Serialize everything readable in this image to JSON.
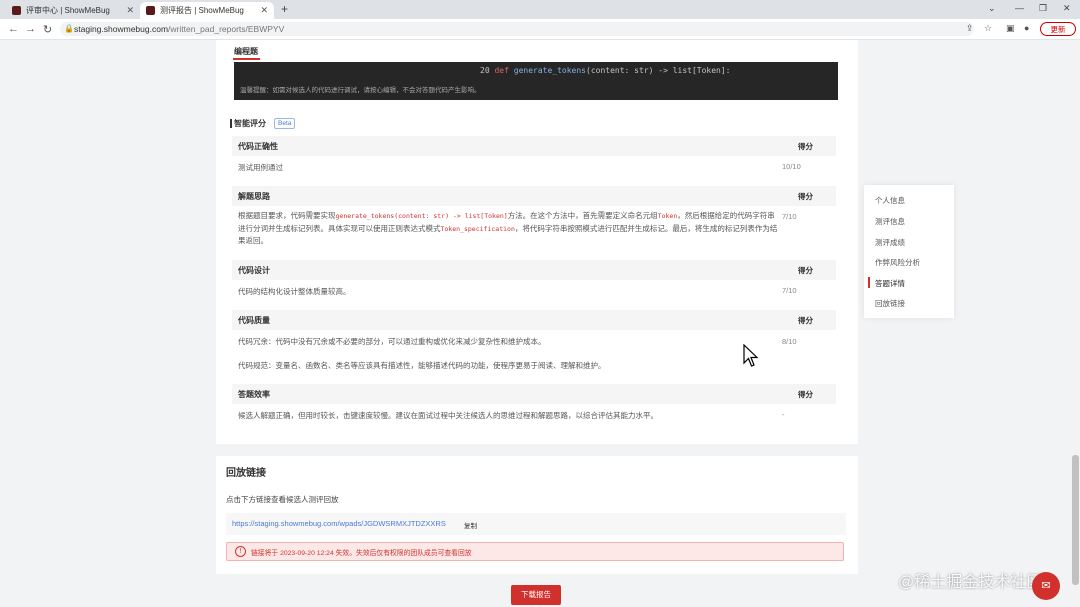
{
  "browser": {
    "tabs": [
      {
        "label": "评审中心 | ShowMeBug"
      },
      {
        "label": "测评报告 | ShowMeBug"
      }
    ],
    "url_host": "staging.showmebug.com",
    "url_path": "/written_pad_reports/EBWPYV",
    "update_label": "更新"
  },
  "code_section": {
    "tab_label": "编程题",
    "code_line_number": "20",
    "code_line_keyword": "def",
    "code_line_fn": "generate_tokens",
    "code_line_rest": "(content: str) -> list[Token]:",
    "notice": "温馨提醒：如需对候选人的代码进行调试，请按心编辑，不会对答题代码产生影响。"
  },
  "ai_score": {
    "title": "智能评分",
    "beta": "Beta",
    "sections": [
      {
        "heading": "代码正确性",
        "score_header": "得分",
        "text": "测试用例通过",
        "score": "10/10"
      },
      {
        "heading": "解题思路",
        "score_header": "得分",
        "text_parts": [
          "根据题目要求，代码需要实现",
          "generate_tokens(content: str) -> list[Token]",
          "方法。在这个方法中，首先需要定义命名元组",
          "Token",
          "，然后根据给定的代码字符串进行分词并生成标记列表。具体实现可以使用正则表达式模式",
          "Token_specification",
          "，将代码字符串按照模式进行匹配并生成标记。最后，将生成的标记列表作为结果返回。"
        ],
        "score": "7/10"
      },
      {
        "heading": "代码设计",
        "score_header": "得分",
        "text": "代码的结构化设计整体质量较高。",
        "score": "7/10"
      },
      {
        "heading": "代码质量",
        "score_header": "得分",
        "text": "代码冗余：代码中没有冗余或不必要的部分，可以通过重构或优化来减少复杂性和维护成本。",
        "text2": "代码规范：变量名、函数名、类名等应该具有描述性，能够描述代码的功能，使程序更易于阅读、理解和维护。",
        "score": "8/10"
      },
      {
        "heading": "答题效率",
        "score_header": "得分",
        "text": "候选人解题正确，但用时较长，击键速度较慢。建议在面试过程中关注候选人的思维过程和解题思路，以综合评估其能力水平。",
        "score": "-"
      }
    ]
  },
  "replay": {
    "title": "回放链接",
    "desc": "点击下方链接查看候选人测评回放",
    "link": "https://staging.showmebug.com/wpads/JGDWSRMXJTDZXXRS",
    "copy": "复制",
    "warning": "链接将于 2023-09-20 12:24 失效。失效后仅有权限的团队成员可查看回放"
  },
  "sidenav": {
    "items": [
      "个人信息",
      "测评信息",
      "测评成绩",
      "作弊风险分析",
      "答题详情",
      "回放链接"
    ],
    "active_index": 4
  },
  "download_label": "下载报告",
  "watermark": "@稀土掘金技术社区"
}
